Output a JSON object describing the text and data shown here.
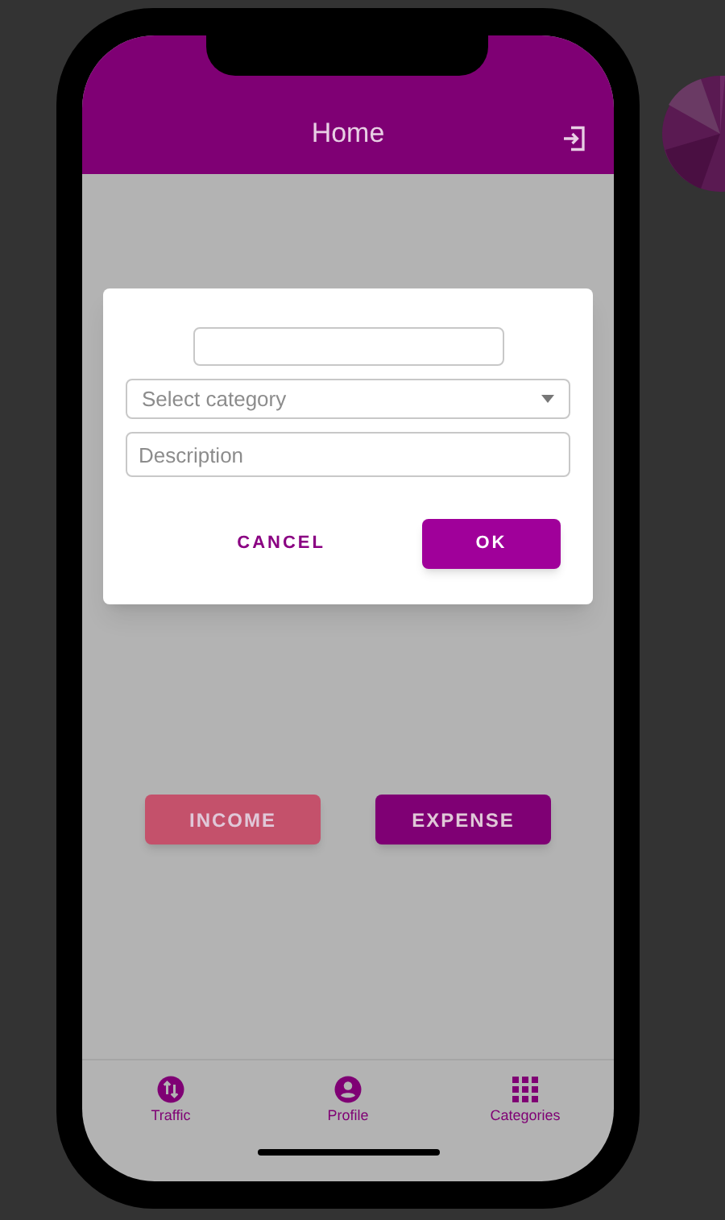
{
  "header": {
    "title": "Home"
  },
  "dialog": {
    "category": {
      "placeholder": "Select category"
    },
    "description": {
      "placeholder": "Description"
    },
    "buttons": [
      {
        "label": "CANCEL",
        "kind": "text"
      },
      {
        "label": "OK",
        "kind": "filled"
      }
    ]
  },
  "actions": [
    {
      "label": "INCOME",
      "kind": "income"
    },
    {
      "label": "EXPENSE",
      "kind": "expense"
    }
  ],
  "nav": [
    {
      "label": "Traffic",
      "kind": "traffic"
    },
    {
      "label": "Profile",
      "kind": "profile"
    },
    {
      "label": "Categories",
      "kind": "categories"
    }
  ]
}
